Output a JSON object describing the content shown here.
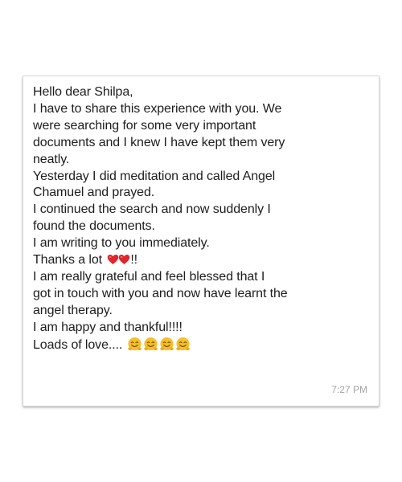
{
  "message": {
    "lines": [
      "Hello dear Shilpa,",
      "I have to share this experience with you. We",
      "were searching for some very important",
      "documents and I knew I have kept them very",
      "neatly.",
      "Yesterday I did meditation and called Angel",
      "Chamuel and prayed.",
      "I continued the search and now suddenly I",
      "found the documents.",
      "I am writing to you immediately.",
      "Thanks a lot",
      "I am really grateful and feel blessed that I",
      "got in touch with you and now have learnt the",
      "angel therapy.",
      "I am happy and thankful!!!!",
      "Loads of love...."
    ],
    "thanks_suffix": "!!",
    "timestamp": "7:27 PM"
  },
  "icons": {
    "heart": "red-heart-icon",
    "smiley": "hugging-face-icon"
  },
  "colors": {
    "heart": "#e0262c",
    "smiley": "#f5c026",
    "timestamp": "#a3a3a3"
  }
}
